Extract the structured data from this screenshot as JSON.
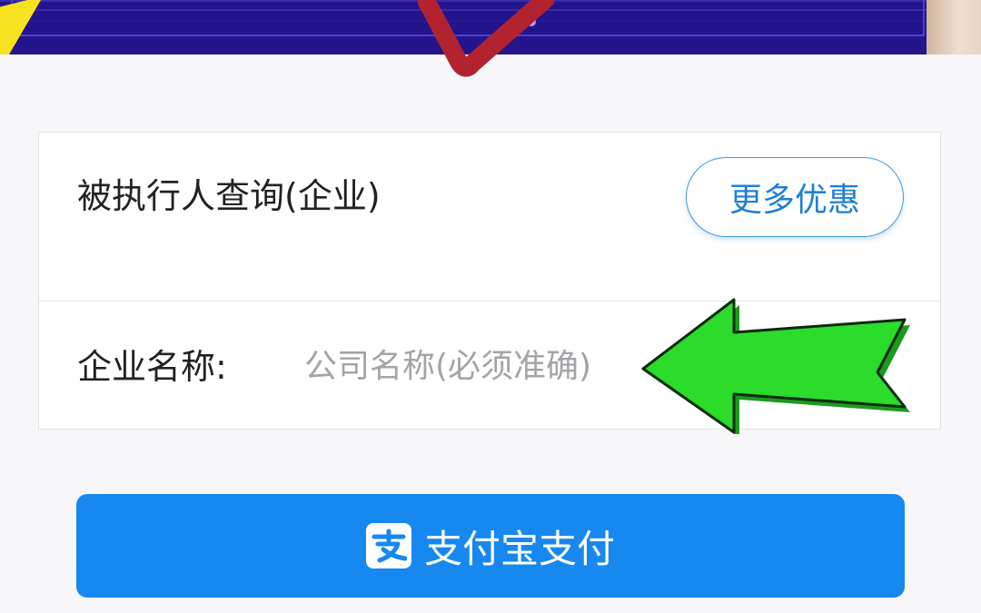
{
  "card": {
    "title": "被执行人查询(企业)",
    "promo_button": "更多优惠",
    "company_label": "企业名称:",
    "company_input": {
      "value": "",
      "placeholder": "公司名称(必须准确)"
    }
  },
  "payment": {
    "button_label": "支付宝支付",
    "icon": "alipay-icon"
  },
  "colors": {
    "banner": "#23148c",
    "accent": "#1688f0",
    "promo_text": "#1f7fd6",
    "annotation_arrow": "#2bdc2b",
    "checkmark": "#b2232f"
  }
}
